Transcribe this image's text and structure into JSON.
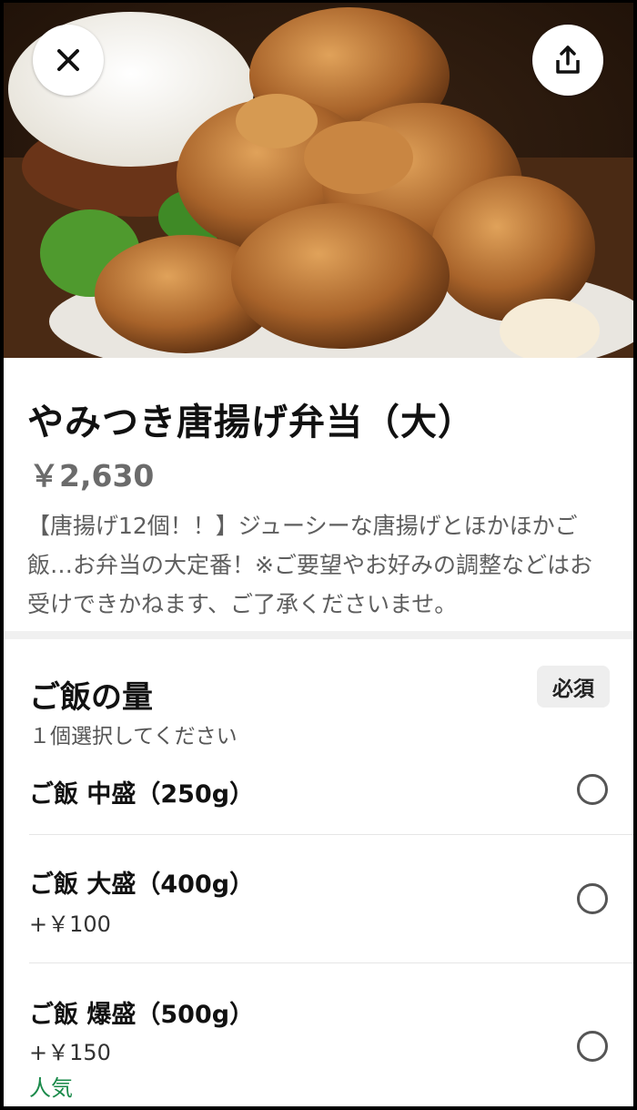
{
  "header": {
    "close_icon": "close-icon",
    "share_icon": "share-icon"
  },
  "product": {
    "title": "やみつき唐揚げ弁当（大）",
    "price": "￥2,630",
    "description": "【唐揚げ12個！！】ジューシーな唐揚げとほかほかご飯…お弁当の大定番！※ご要望やお好みの調整などはお受けできかねます、ご了承くださいませ。"
  },
  "options_group": {
    "title": "ご飯の量",
    "subtitle": "１個選択してください",
    "badge": "必須",
    "options": [
      {
        "label": "ご飯 中盛（250g）",
        "price": "",
        "tag": ""
      },
      {
        "label": "ご飯 大盛（400g）",
        "price": "+￥100",
        "tag": ""
      },
      {
        "label": "ご飯 爆盛（500g）",
        "price": "+￥150",
        "tag": "人気"
      }
    ]
  },
  "colors": {
    "accent_green": "#1a8a4a",
    "price_gray": "#6b6b6b",
    "band_gray": "#f0f0f0"
  }
}
